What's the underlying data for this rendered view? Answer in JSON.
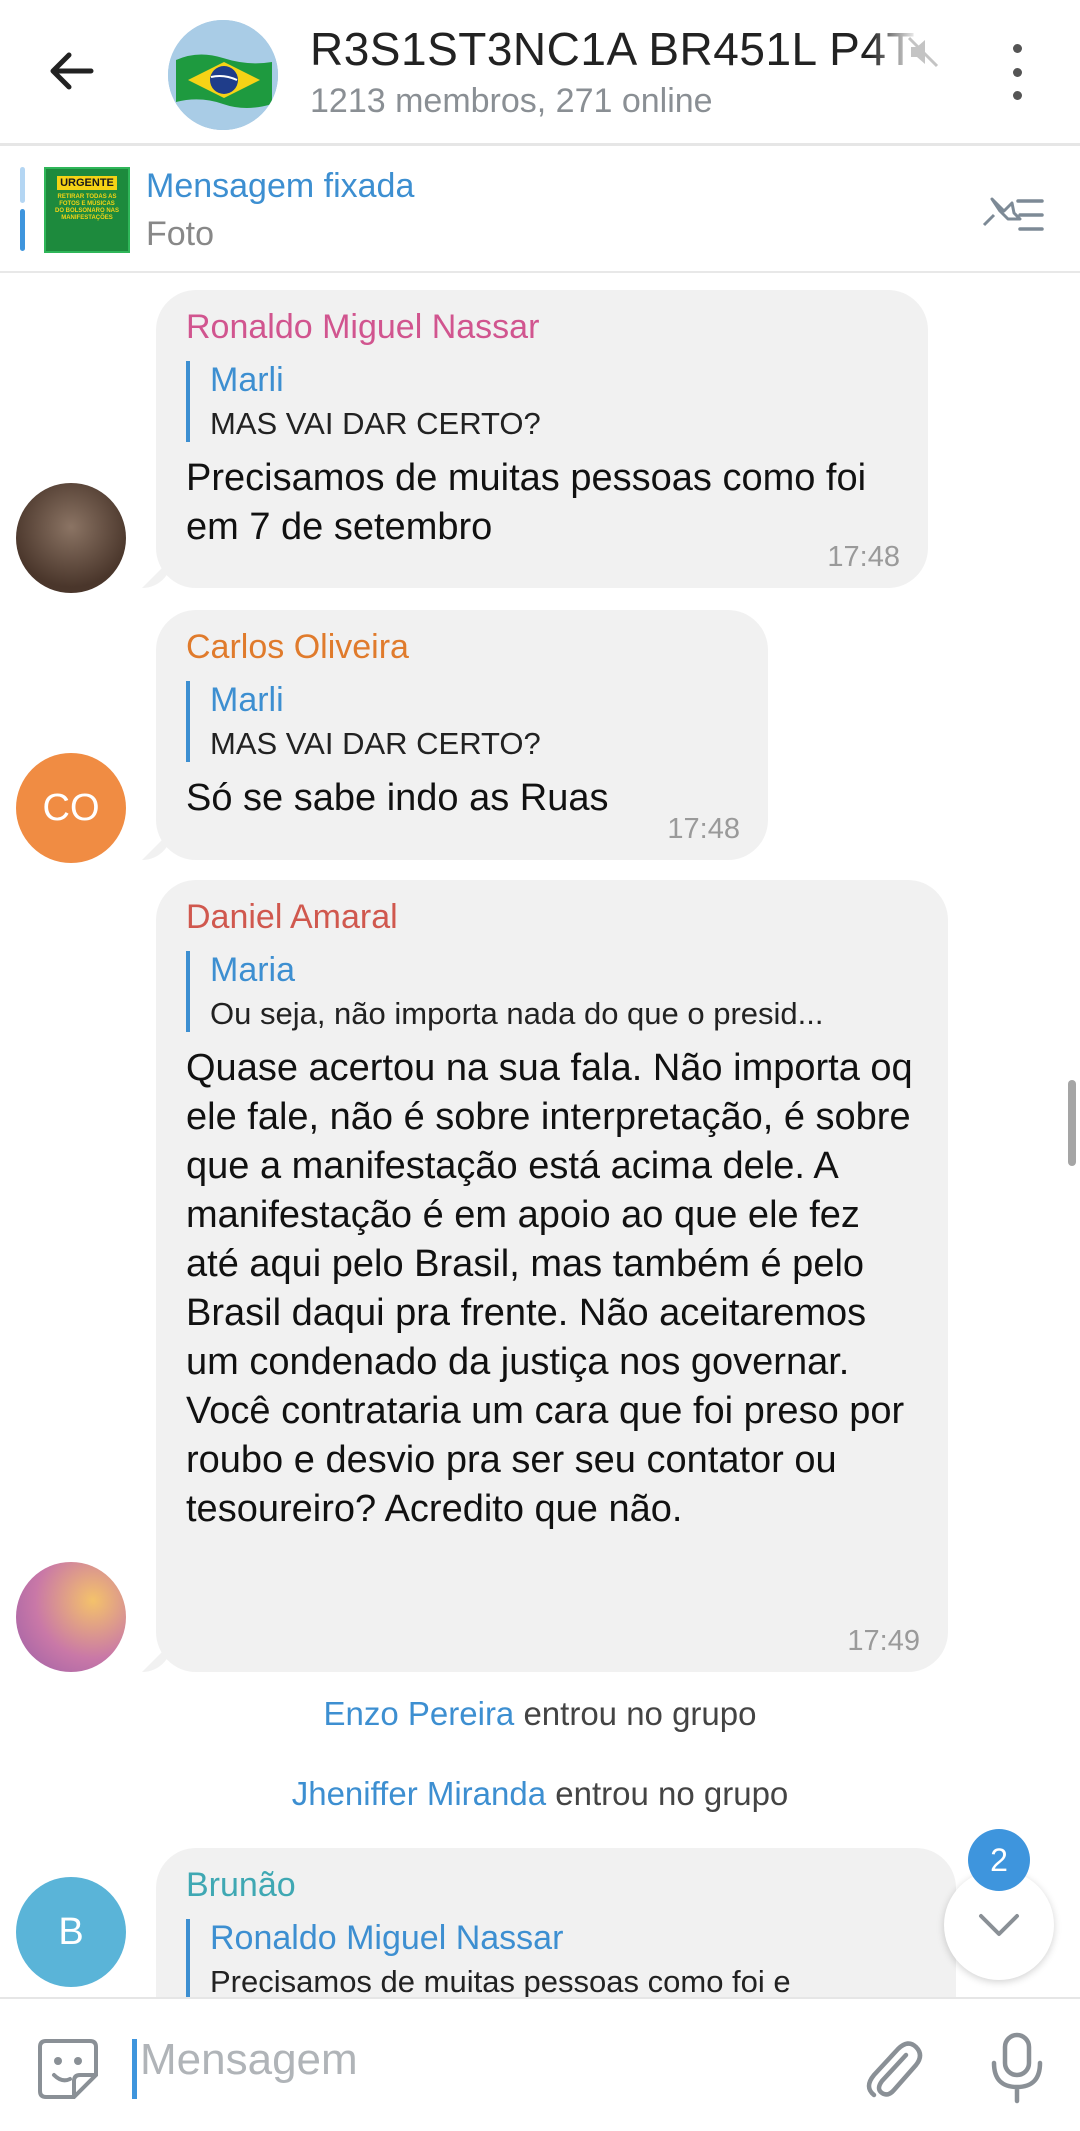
{
  "header": {
    "title": "R3S1ST3NC1A BR451L P4T",
    "subtitle": "1213 membros, 271 online"
  },
  "pinned": {
    "title": "Mensagem fixada",
    "subtitle": "Foto",
    "thumb_badge": "URGENTE",
    "thumb_lines": [
      "RETIRAR TODAS AS",
      "FOTOS E MÚSICAS",
      "DO BOLSONARO NAS",
      "MANIFESTAÇÕES"
    ]
  },
  "messages": [
    {
      "sender": "Ronaldo Miguel Nassar",
      "sender_color": "#d1558f",
      "reply_name": "Marli",
      "reply_text": "MAS VAI DAR CERTO?",
      "text": "Precisamos de muitas pessoas como foi em 7 de setembro",
      "time": "17:48"
    },
    {
      "sender": "Carlos Oliveira",
      "sender_color": "#e07b2c",
      "avatar_initials": "CO",
      "reply_name": "Marli",
      "reply_text": "MAS VAI DAR CERTO?",
      "text": "Só se sabe indo as Ruas",
      "time": "17:48"
    },
    {
      "sender": "Daniel Amaral",
      "sender_color": "#d0584e",
      "reply_name": "Maria",
      "reply_text": "Ou seja, não importa nada do que o presid...",
      "text": "Quase acertou na sua fala. Não importa oq ele fale, não é sobre interpretação, é sobre que a manifestação está acima dele. A manifestação é em apoio ao que ele fez até aqui pelo Brasil, mas também é pelo Brasil daqui pra frente. Não aceitaremos um condenado da justiça nos governar. Você contrataria um cara que foi preso por roubo e desvio pra ser seu contator ou tesoureiro? Acredito que não.",
      "time": "17:49"
    },
    {
      "sender": "Brunão",
      "sender_color": "#3fa8b3",
      "avatar_initials": "B",
      "reply_name": "Ronaldo Miguel Nassar",
      "reply_text": "Precisamos de muitas pessoas como foi e"
    }
  ],
  "system": [
    {
      "who": "Enzo Pereira",
      "action": "entrou no grupo"
    },
    {
      "who": "Jheniffer Miranda",
      "action": "entrou no grupo"
    }
  ],
  "unread_count": "2",
  "composer": {
    "placeholder": "Mensagem"
  },
  "colors": {
    "accent": "#3e95dd",
    "bubble": "#f1f1f1"
  }
}
